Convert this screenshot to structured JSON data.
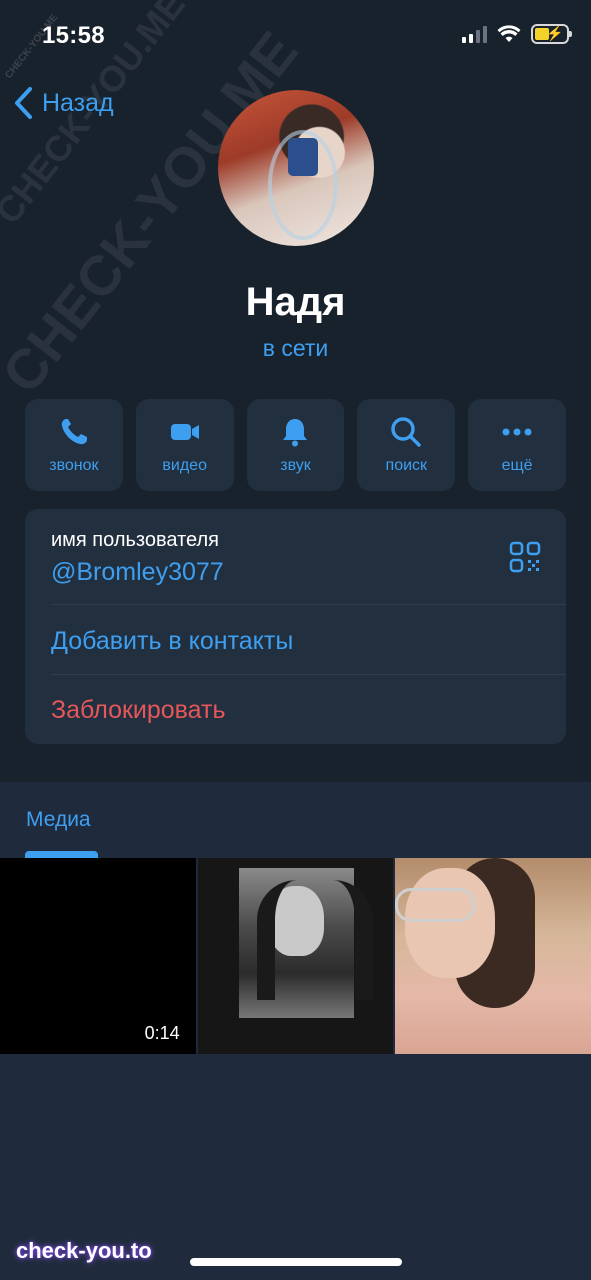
{
  "status_bar": {
    "time": "15:58"
  },
  "nav": {
    "back_label": "Назад"
  },
  "profile": {
    "name": "Надя",
    "status": "в сети"
  },
  "actions": [
    {
      "label": "звонок",
      "icon": "phone-icon"
    },
    {
      "label": "видео",
      "icon": "video-icon"
    },
    {
      "label": "звук",
      "icon": "bell-icon"
    },
    {
      "label": "поиск",
      "icon": "search-icon"
    },
    {
      "label": "ещё",
      "icon": "more-icon"
    }
  ],
  "info": {
    "username_title": "имя пользователя",
    "username": "@Bromley3077",
    "add_contact": "Добавить в контакты",
    "block": "Заблокировать"
  },
  "media": {
    "tab_label": "Медиа",
    "items": [
      {
        "duration": "0:14"
      }
    ]
  },
  "watermarks": {
    "main": "CHECK-YOU.ME",
    "site": "check-you.to"
  },
  "colors": {
    "accent": "#3e9ff0",
    "danger": "#e5575a",
    "background": "#18222d",
    "card": "#222f3f"
  }
}
